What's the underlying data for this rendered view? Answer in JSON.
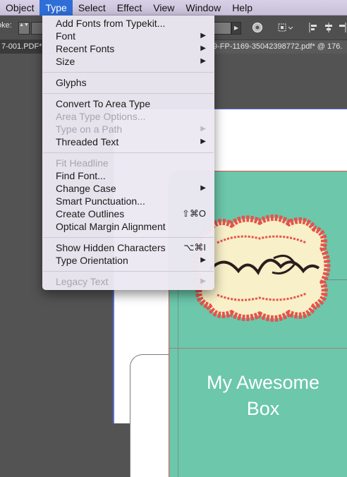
{
  "menubar": {
    "items": [
      "Object",
      "Type",
      "Select",
      "Effect",
      "View",
      "Window",
      "Help"
    ],
    "active_index": 1
  },
  "controlbar": {
    "stroke_label": "oke:",
    "stepper_glyph": "▲▼",
    "opacity_arrow": "▶",
    "icons": [
      "recolor-icon",
      "align-select-icon",
      "align-left-icon",
      "align-center-icon",
      "align-right-icon"
    ]
  },
  "tabs": {
    "left": "7-001.PDF*",
    "right": "9-FP-1169-35042398772.pdf* @ 176."
  },
  "type_menu": {
    "groups": [
      [
        {
          "label": "Add Fonts from Typekit...",
          "enabled": true,
          "submenu": false,
          "shortcut": ""
        },
        {
          "label": "Font",
          "enabled": true,
          "submenu": true,
          "shortcut": ""
        },
        {
          "label": "Recent Fonts",
          "enabled": true,
          "submenu": true,
          "shortcut": ""
        },
        {
          "label": "Size",
          "enabled": true,
          "submenu": true,
          "shortcut": ""
        }
      ],
      [
        {
          "label": "Glyphs",
          "enabled": true,
          "submenu": false,
          "shortcut": ""
        }
      ],
      [
        {
          "label": "Convert To Area Type",
          "enabled": true,
          "submenu": false,
          "shortcut": ""
        },
        {
          "label": "Area Type Options...",
          "enabled": false,
          "submenu": false,
          "shortcut": ""
        },
        {
          "label": "Type on a Path",
          "enabled": false,
          "submenu": true,
          "shortcut": ""
        },
        {
          "label": "Threaded Text",
          "enabled": true,
          "submenu": true,
          "shortcut": ""
        }
      ],
      [
        {
          "label": "Fit Headline",
          "enabled": false,
          "submenu": false,
          "shortcut": ""
        },
        {
          "label": "Find Font...",
          "enabled": true,
          "submenu": false,
          "shortcut": ""
        },
        {
          "label": "Change Case",
          "enabled": true,
          "submenu": true,
          "shortcut": ""
        },
        {
          "label": "Smart Punctuation...",
          "enabled": true,
          "submenu": false,
          "shortcut": ""
        },
        {
          "label": "Create Outlines",
          "enabled": true,
          "submenu": false,
          "shortcut": "⇧⌘O"
        },
        {
          "label": "Optical Margin Alignment",
          "enabled": true,
          "submenu": false,
          "shortcut": ""
        }
      ],
      [
        {
          "label": "Show Hidden Characters",
          "enabled": true,
          "submenu": false,
          "shortcut": "⌥⌘I"
        },
        {
          "label": "Type Orientation",
          "enabled": true,
          "submenu": true,
          "shortcut": ""
        }
      ],
      [
        {
          "label": "Legacy Text",
          "enabled": false,
          "submenu": true,
          "shortcut": ""
        }
      ]
    ],
    "submenu_glyph": "▶"
  },
  "artwork": {
    "title_line1": "My Awesome",
    "title_line2": "Box",
    "panel_color": "#6cc7ab",
    "outline_color": "#e8524a",
    "label_fill": "#f7f0c8"
  }
}
